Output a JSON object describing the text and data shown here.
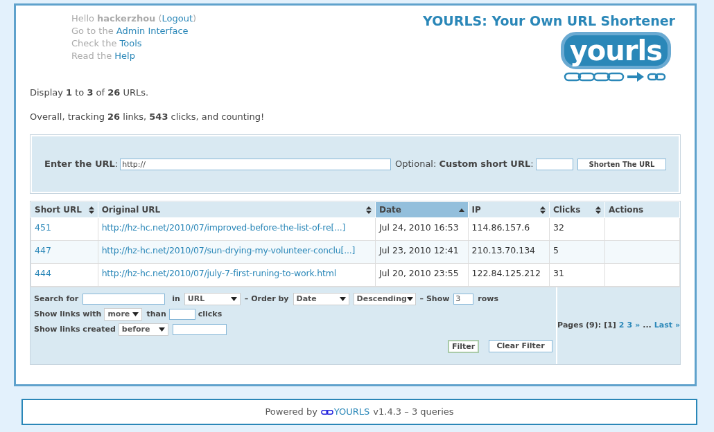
{
  "header": {
    "user_lines": [
      [
        {
          "kind": "text",
          "text": "Hello "
        },
        {
          "kind": "bold",
          "text": "hackerzhou"
        },
        {
          "kind": "text",
          "text": " ("
        },
        {
          "kind": "link",
          "text": "Logout"
        },
        {
          "kind": "text",
          "text": ")"
        }
      ],
      [
        {
          "kind": "text",
          "text": "Go to the "
        },
        {
          "kind": "link",
          "text": "Admin Interface"
        }
      ],
      [
        {
          "kind": "text",
          "text": "Check the "
        },
        {
          "kind": "link",
          "text": "Tools"
        }
      ],
      [
        {
          "kind": "text",
          "text": "Read the "
        },
        {
          "kind": "link",
          "text": "Help"
        }
      ]
    ],
    "title": "YOURLS: Your Own URL Shortener",
    "logo_text": "yourls"
  },
  "stats": [
    "Display **1** to **3** of **26** URLs.",
    "Overall, tracking **26** links, **543** clicks, and counting!"
  ],
  "new_url_form": {
    "url_label": "**Enter the URL**:",
    "url_value": "http://",
    "custom_label": "Optional: **Custom short URL**:",
    "submit": "Shorten The URL"
  },
  "table": {
    "columns": [
      {
        "label": "Short URL",
        "sortable": true,
        "selected": false
      },
      {
        "label": "Original URL",
        "sortable": true,
        "selected": false
      },
      {
        "label": "Date",
        "sortable": true,
        "selected": true
      },
      {
        "label": "IP",
        "sortable": true,
        "selected": false
      },
      {
        "label": "Clicks",
        "sortable": true,
        "selected": false
      },
      {
        "label": "Actions",
        "sortable": false,
        "selected": false
      }
    ],
    "rows": [
      {
        "short_url": "451",
        "original_url": "http://hz-hc.net/2010/07/improved-before-the-list-of-re[...]",
        "date": "Jul 24, 2010 16:53",
        "ip": "114.86.157.6",
        "clicks": "32"
      },
      {
        "short_url": "447",
        "original_url": "http://hz-hc.net/2010/07/sun-drying-my-volunteer-conclu[...]",
        "date": "Jul 23, 2010 12:41",
        "ip": "210.13.70.134",
        "clicks": "5"
      },
      {
        "short_url": "444",
        "original_url": "http://hz-hc.net/2010/07/july-7-first-runing-to-work.html",
        "date": "Jul 20, 2010 23:55",
        "ip": "122.84.125.212",
        "clicks": "31"
      }
    ]
  },
  "filter": {
    "search_label": "Search for",
    "in_label": "in",
    "in_select": "URL",
    "order_label": "– Order by",
    "order_select": "Date",
    "direction_select": "Descending",
    "show_label": "– Show",
    "show_value": "3",
    "rows_label": "rows",
    "links_with_label": "Show links with",
    "links_with_select": "more",
    "than_label": "than",
    "clicks_label": "clicks",
    "created_label": "Show links created",
    "created_select": "before",
    "filter_button": "Filter",
    "clear_button": "Clear Filter"
  },
  "pagination": {
    "label": "Pages (9):",
    "current": "[1]",
    "pages": [
      "2",
      "3"
    ],
    "next": "»",
    "ellipsis": "...",
    "last": "Last »"
  },
  "footer": {
    "prefix": "Powered by",
    "link": "YOURLS",
    "suffix": "v1.4.3 – 3 queries"
  }
}
